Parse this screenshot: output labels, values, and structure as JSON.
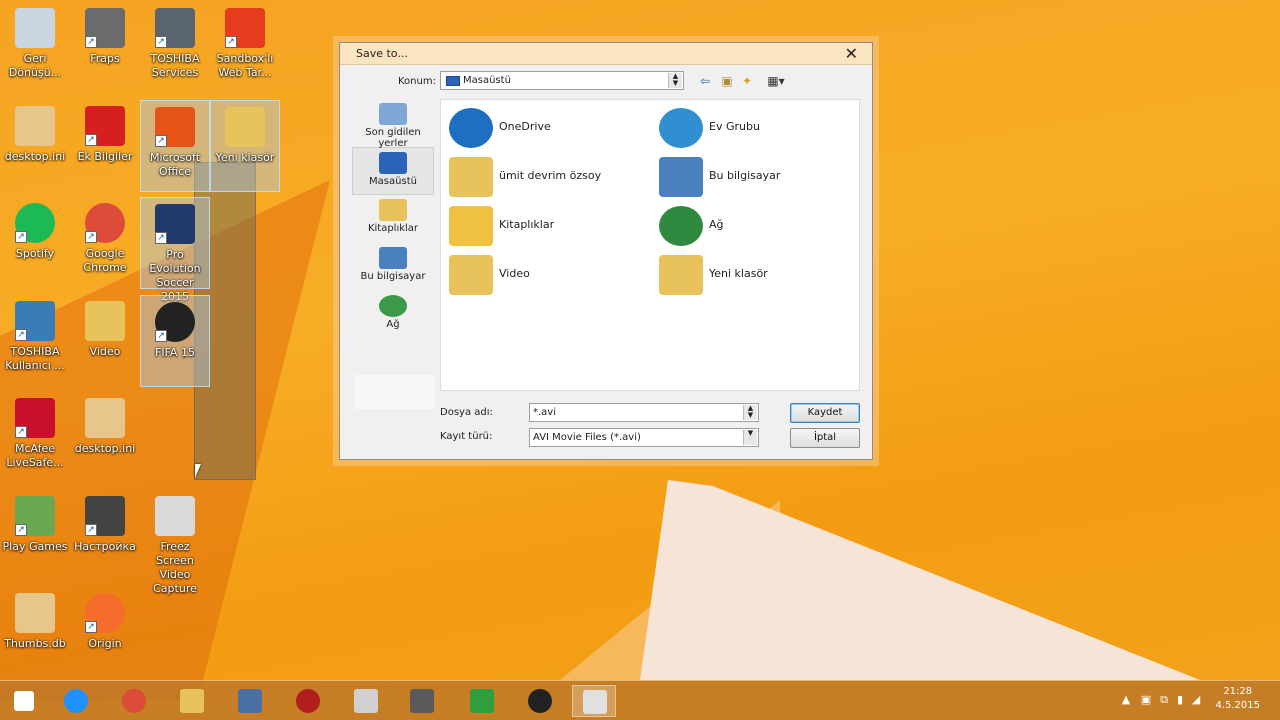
{
  "desktop_icons": [
    {
      "id": "geri-donusum",
      "label": "Geri\nDönüşü...",
      "icon": "recycle-bin-icon",
      "shortcut": false
    },
    {
      "id": "fraps",
      "label": "Fraps",
      "icon": "fraps-icon",
      "shortcut": true
    },
    {
      "id": "toshiba-services",
      "label": "TOSHIBA\nServices",
      "icon": "toshiba-services-icon",
      "shortcut": true
    },
    {
      "id": "sandboxli",
      "label": "Sandbox'lı\nWeb Tar...",
      "icon": "sandbox-browser-icon",
      "shortcut": true
    },
    {
      "id": "desktop-ini-1",
      "label": "desktop.ini",
      "icon": "config-file-icon",
      "shortcut": false
    },
    {
      "id": "ek-bilgiler",
      "label": "Ek Bilgiler",
      "icon": "info-icon",
      "shortcut": true
    },
    {
      "id": "microsoft-office",
      "label": "Microsoft\nOffice",
      "icon": "office-icon",
      "shortcut": true
    },
    {
      "id": "yeni-klasor",
      "label": "Yeni klasör",
      "icon": "folder-icon",
      "shortcut": false
    },
    {
      "id": "spotify",
      "label": "Spotify",
      "icon": "spotify-icon",
      "shortcut": true
    },
    {
      "id": "google-chrome",
      "label": "Google\nChrome",
      "icon": "chrome-icon",
      "shortcut": true
    },
    {
      "id": "pes-2015",
      "label": "Pro Evolution\nSoccer 2015",
      "icon": "pes-icon",
      "shortcut": true
    },
    {
      "id": "toshiba-kullanici",
      "label": "TOSHIBA\nKullanıcı ...",
      "icon": "toshiba-manual-icon",
      "shortcut": true
    },
    {
      "id": "video",
      "label": "Video",
      "icon": "folder-icon",
      "shortcut": false
    },
    {
      "id": "fifa-15",
      "label": "FIFA 15",
      "icon": "fifa-icon",
      "shortcut": true
    },
    {
      "id": "mcafee",
      "label": "McAfee\nLiveSafe...",
      "icon": "mcafee-icon",
      "shortcut": true
    },
    {
      "id": "desktop-ini-2",
      "label": "desktop.ini",
      "icon": "config-file-icon",
      "shortcut": false
    },
    {
      "id": "play-games",
      "label": "Play Games",
      "icon": "play-games-icon",
      "shortcut": true
    },
    {
      "id": "nastroika",
      "label": "Настройка",
      "icon": "settings-gear-icon",
      "shortcut": true
    },
    {
      "id": "freez",
      "label": "Freez Screen\nVideo\nCapture",
      "icon": "camera-icon",
      "shortcut": false
    },
    {
      "id": "thumbs-db",
      "label": "Thumbs.db",
      "icon": "config-file-icon",
      "shortcut": false
    },
    {
      "id": "origin",
      "label": "Origin",
      "icon": "origin-icon",
      "shortcut": true
    }
  ],
  "dialog": {
    "title": "Save to...",
    "close_symbol": "✕",
    "location_label": "Konum:",
    "location_value": "Masaüstü",
    "toolbar": {
      "back": "⇦",
      "up": "▣",
      "new_folder": "✦",
      "view": "▦▾"
    },
    "places": [
      {
        "label": "Son gidilen yerler",
        "icon": "recent-places-icon",
        "active": false
      },
      {
        "label": "Masaüstü",
        "icon": "desktop-icon",
        "active": true
      },
      {
        "label": "Kitaplıklar",
        "icon": "libraries-icon",
        "active": false
      },
      {
        "label": "Bu bilgisayar",
        "icon": "computer-icon",
        "active": false
      },
      {
        "label": "Ağ",
        "icon": "network-icon",
        "active": false
      }
    ],
    "files": [
      {
        "label": "OneDrive",
        "icon": "onedrive-icon"
      },
      {
        "label": "Ev Grubu",
        "icon": "homegroup-icon"
      },
      {
        "label": "ümit devrim özsoy",
        "icon": "user-folder-icon"
      },
      {
        "label": "Bu bilgisayar",
        "icon": "computer-icon"
      },
      {
        "label": "Kitaplıklar",
        "icon": "libraries-icon"
      },
      {
        "label": "Ağ",
        "icon": "network-icon"
      },
      {
        "label": "Video",
        "icon": "folder-icon"
      },
      {
        "label": "Yeni klasör",
        "icon": "folder-icon"
      }
    ],
    "filename_label": "Dosya adı:",
    "filename_value": "*.avi",
    "filetype_label": "Kayıt türü:",
    "filetype_value": "AVI Movie Files (*.avi)",
    "save_button": "Kaydet",
    "cancel_button": "İptal"
  },
  "taskbar": {
    "items": [
      {
        "name": "start-button",
        "icon": "windows-logo-icon"
      },
      {
        "name": "taskbar-internet-explorer",
        "icon": "ie-icon"
      },
      {
        "name": "taskbar-chrome",
        "icon": "chrome-icon"
      },
      {
        "name": "taskbar-file-explorer",
        "icon": "file-explorer-icon"
      },
      {
        "name": "taskbar-remote",
        "icon": "remote-desktop-icon"
      },
      {
        "name": "taskbar-media",
        "icon": "media-player-icon"
      },
      {
        "name": "taskbar-window",
        "icon": "window-icon"
      },
      {
        "name": "taskbar-fraps",
        "icon": "fraps-icon"
      },
      {
        "name": "taskbar-store",
        "icon": "store-icon"
      },
      {
        "name": "taskbar-fifa",
        "icon": "fifa-icon"
      },
      {
        "name": "taskbar-freez",
        "icon": "camera-icon"
      }
    ],
    "clock_time": "21:28",
    "clock_date": "4.5.2015"
  },
  "colors": {
    "desktop_orange": "#f6a421",
    "dialog_title_bg": "#fbe5c0",
    "selection_blue": "#2a63b8"
  }
}
